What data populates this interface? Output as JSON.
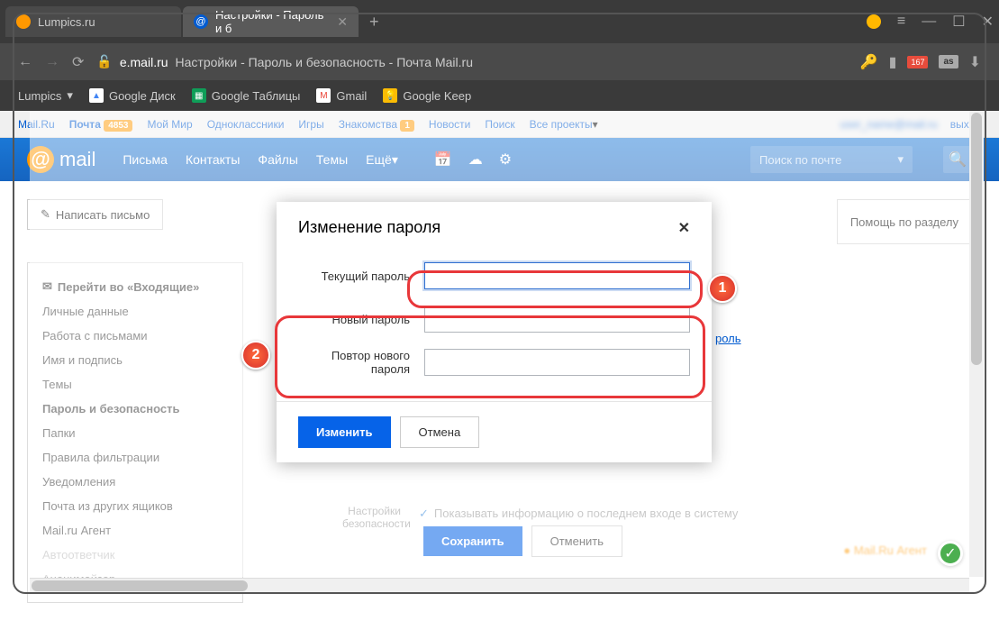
{
  "browser": {
    "tabs": [
      {
        "title": "Lumpics.ru",
        "favicon_bg": "#ff9800"
      },
      {
        "title": "Настройки - Пароль и б",
        "favicon_bg": "#005bd1"
      }
    ],
    "controls": {
      "minimize": "—",
      "maximize": "☐",
      "close": "✕",
      "menu": "≡"
    },
    "url": {
      "host": "e.mail.ru",
      "path": "Настройки - Пароль и безопасность - Почта Mail.ru",
      "lock": "🔓"
    },
    "url_icons": {
      "key": "🔑",
      "bookmark": "⭐",
      "badge_count": "167",
      "lastfm": "as",
      "download": "⬇"
    }
  },
  "bookmarks": [
    {
      "label": "Lumpics",
      "dropdown": "▾"
    },
    {
      "label": "Google Диск",
      "icon_bg": "#4285f4"
    },
    {
      "label": "Google Таблицы",
      "icon_bg": "#0f9d58"
    },
    {
      "label": "Gmail",
      "icon_bg": "#ea4335"
    },
    {
      "label": "Google Keep",
      "icon_bg": "#fbbc04"
    }
  ],
  "mailru_top": {
    "links": [
      "Mail.Ru",
      "Почта",
      "Мой Мир",
      "Одноклассники",
      "Игры",
      "Знакомства",
      "Новости",
      "Поиск",
      "Все проекты"
    ],
    "mail_badge": "4853",
    "dating_badge": "1",
    "dropdown": "▾",
    "user": "user_name@mail.ru",
    "logout": "выход"
  },
  "mailru_header": {
    "logo_text": "mail",
    "nav": [
      "Письма",
      "Контакты",
      "Файлы",
      "Темы",
      "Ещё"
    ],
    "dropdown": "▾",
    "search_placeholder": "Поиск по почте"
  },
  "buttons": {
    "compose": "Написать письмо",
    "help": "Помощь по разделу"
  },
  "sidebar": {
    "inbox": "Перейти во «Входящие»",
    "items": [
      "Личные данные",
      "Работа с письмами",
      "Имя и подпись",
      "Темы",
      "Пароль и безопасность",
      "Папки",
      "Правила фильтрации",
      "Уведомления",
      "Почта из других ящиков",
      "Mail.ru Агент",
      "Автоответчик",
      "Анонимайзер"
    ],
    "active_index": 4
  },
  "modal": {
    "title": "Изменение пароля",
    "close": "✕",
    "labels": {
      "current": "Текущий пароль",
      "new": "Новый пароль",
      "repeat": "Повтор нового пароля"
    },
    "submit": "Изменить",
    "cancel": "Отмена"
  },
  "background": {
    "settings_label": "Настройки безопасности",
    "show_login_info": "Показывать информацию о последнем входе в систему",
    "password_link": "роль",
    "save": "Сохранить",
    "cancel2": "Отменить",
    "agent": "Mail.Ru Агент"
  },
  "annotations": {
    "one": "1",
    "two": "2"
  }
}
